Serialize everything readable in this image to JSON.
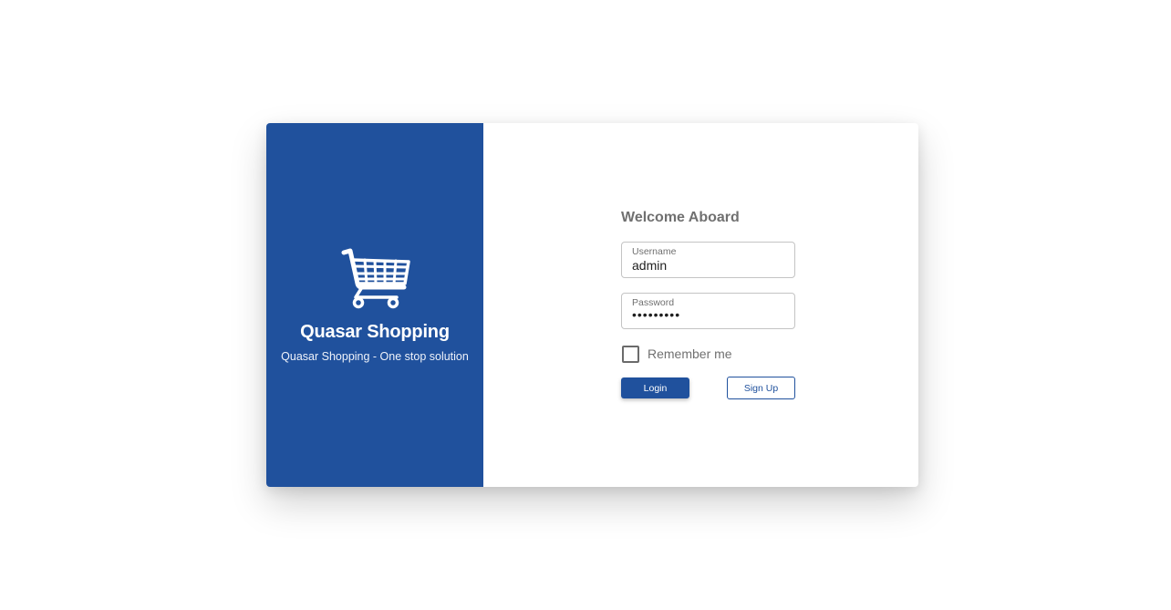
{
  "brand": {
    "icon": "shopping-cart-icon",
    "title": "Quasar Shopping",
    "subtitle": "Quasar Shopping - One stop solution",
    "color": "#20519d"
  },
  "login": {
    "heading": "Welcome Aboard",
    "username": {
      "label": "Username",
      "value": "admin"
    },
    "password": {
      "label": "Password",
      "value": "•••••••••"
    },
    "remember_label": "Remember me",
    "remember_checked": false,
    "login_button": "Login",
    "signup_button": "Sign Up"
  }
}
